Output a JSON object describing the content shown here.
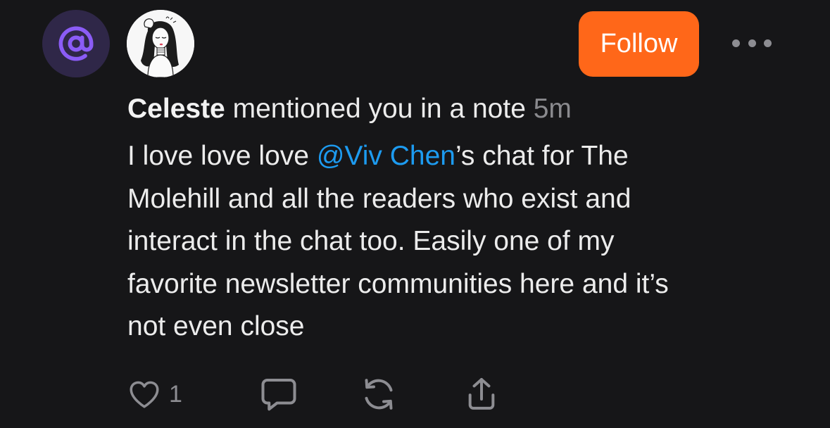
{
  "notification": {
    "type_icon": "at-sign-icon",
    "avatar_icon": "user-avatar-illustration",
    "user_name": "Celeste",
    "action_text": " mentioned you in a note ",
    "time_ago": "5m"
  },
  "header": {
    "follow_label": "Follow",
    "more_icon": "more-horizontal-icon"
  },
  "note": {
    "line1_before": "I love love love ",
    "mention": "@Viv Chen",
    "line1_after": "’s chat for The",
    "line2": "Molehill and all the readers who exist and",
    "line3": "interact in the chat too. Easily one of my",
    "line4": "favorite newsletter communities here and it’s",
    "line5": "not even close"
  },
  "actions": {
    "like_icon": "heart-icon",
    "like_count": "1",
    "comment_icon": "comment-bubble-icon",
    "restack_icon": "restack-icon",
    "share_icon": "share-icon"
  },
  "colors": {
    "background": "#161618",
    "accent": "#ff6719",
    "mention_link": "#1d9bf0",
    "badge_bg": "#2f2748",
    "badge_fg": "#8b5cf6",
    "muted": "#8a8a8e"
  }
}
